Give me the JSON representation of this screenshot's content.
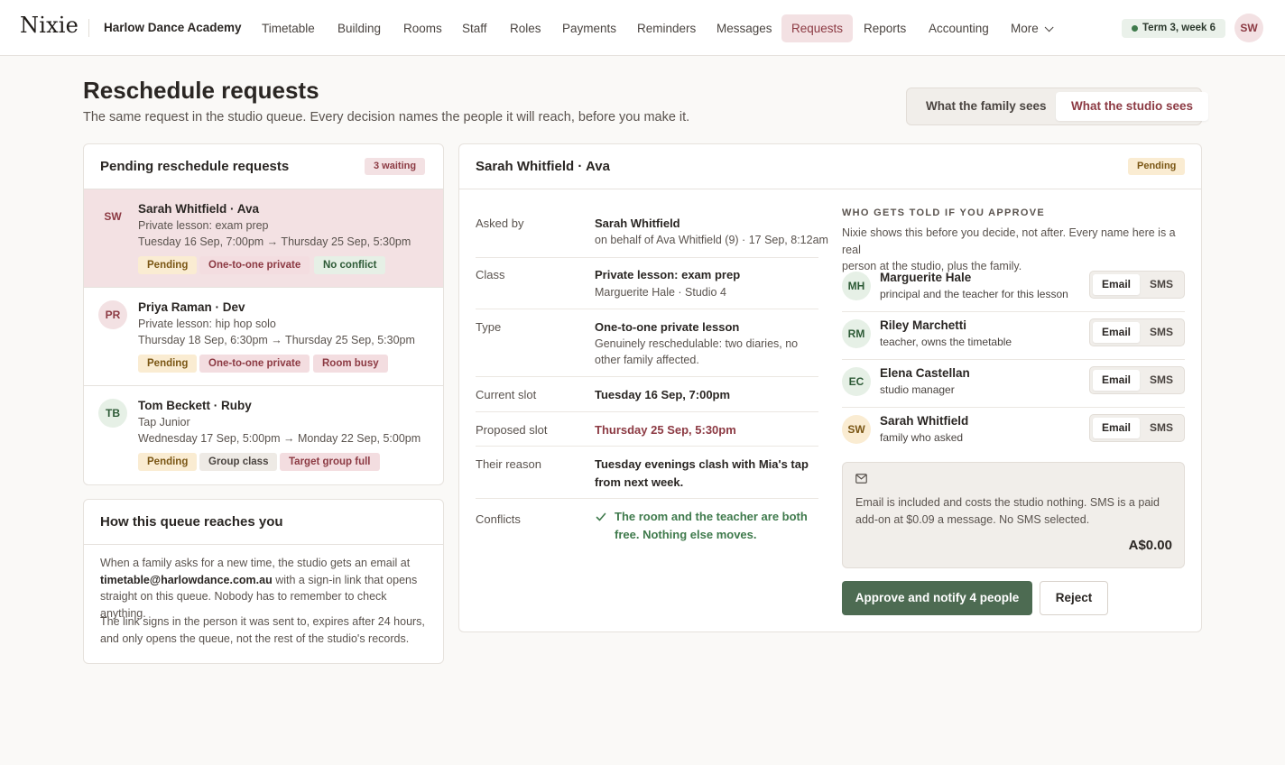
{
  "app": {
    "logo": "Nixie",
    "academy": "Harlow Dance Academy",
    "nav": [
      "Timetable",
      "Building",
      "Rooms",
      "Staff",
      "Roles",
      "Payments",
      "Reminders",
      "Messages",
      "Requests",
      "Reports",
      "Accounting",
      "More"
    ],
    "active_nav": "Requests",
    "term": "Term 3, week 6",
    "user_initials": "SW"
  },
  "header": {
    "title": "Reschedule requests",
    "subtitle": "The same request in the studio queue. Every decision names the people it will reach, before you make it.",
    "view_family": "What the family sees",
    "view_studio": "What the studio sees"
  },
  "queue": {
    "title": "Pending reschedule requests",
    "count_badge": "3 waiting",
    "items": [
      {
        "initials": "SW",
        "name": "Sarah Whitfield · Ava",
        "class": "Private lesson: exam prep",
        "slot": "Tuesday 16 Sep, 7:00pm → Thursday 25 Sep, 5:30pm",
        "tags": [
          "Pending",
          "One-to-one private",
          "No conflict"
        ]
      },
      {
        "initials": "PR",
        "name": "Priya Raman · Dev",
        "class": "Private lesson: hip hop solo",
        "slot": "Thursday 18 Sep, 6:30pm → Thursday 25 Sep, 5:30pm",
        "tags": [
          "Pending",
          "One-to-one private",
          "Room busy"
        ]
      },
      {
        "initials": "TB",
        "name": "Tom Beckett · Ruby",
        "class": "Tap Junior",
        "slot": "Wednesday 17 Sep, 5:00pm → Monday 22 Sep, 5:00pm",
        "tags": [
          "Pending",
          "Group class",
          "Target group full"
        ]
      }
    ]
  },
  "how": {
    "title": "How this queue reaches you",
    "p1_a": "When a family asks for a new time, the studio gets an email at",
    "p1_email": "timetable@harlowdance.com.au",
    "p1_b": "with a sign-in link that opens",
    "p1_c": "straight on this queue. Nobody has to remember to check anything.",
    "p2_a": "The link signs in the person it was sent to, expires after 24 hours,",
    "p2_b": "and only opens the queue, not the rest of the studio's records."
  },
  "detail": {
    "title": "Sarah Whitfield · Ava",
    "status": "Pending",
    "asked_by_label": "Asked by",
    "asked_by": "Sarah Whitfield",
    "asked_by_sub": "on behalf of Ava Whitfield (9) · 17 Sep, 8:12am",
    "class_label": "Class",
    "class": "Private lesson: exam prep",
    "class_sub": "Marguerite Hale · Studio 4",
    "type_label": "Type",
    "type": "One-to-one private lesson",
    "type_sub1": "Genuinely reschedulable: two diaries, no",
    "type_sub2": "other family affected.",
    "current_label": "Current slot",
    "current": "Tuesday 16 Sep, 7:00pm",
    "proposed_label": "Proposed slot",
    "proposed": "Thursday 25 Sep, 5:30pm",
    "reason_label": "Their reason",
    "reason1": "Tuesday evenings clash with Mia's tap",
    "reason2": "from next week.",
    "conflicts_label": "Conflicts",
    "conflicts1": "The room and the teacher are both",
    "conflicts2": "free. Nothing else moves."
  },
  "who": {
    "heading": "WHO GETS TOLD IF YOU APPROVE",
    "desc1": "Nixie shows this before you decide, not after. Every name here is a real",
    "desc2": "person at the studio, plus the family.",
    "people": [
      {
        "initials": "MH",
        "name": "Marguerite Hale",
        "role": "principal and the teacher for this lesson"
      },
      {
        "initials": "RM",
        "name": "Riley Marchetti",
        "role": "teacher, owns the timetable"
      },
      {
        "initials": "EC",
        "name": "Elena Castellan",
        "role": "studio manager"
      },
      {
        "initials": "SW",
        "name": "Sarah Whitfield",
        "role": "family who asked"
      }
    ],
    "email_label": "Email",
    "sms_label": "SMS",
    "cost_text1": "Email is included and costs the studio nothing. SMS is a paid",
    "cost_text2": "add-on at $0.09 a message. No SMS selected.",
    "cost_total": "A$0.00",
    "approve": "Approve and notify 4 people",
    "reject": "Reject"
  },
  "colors": {
    "accent_rose": "#8c3a43",
    "primary_green": "#4d6b52",
    "success_green": "#3f7a4c"
  }
}
